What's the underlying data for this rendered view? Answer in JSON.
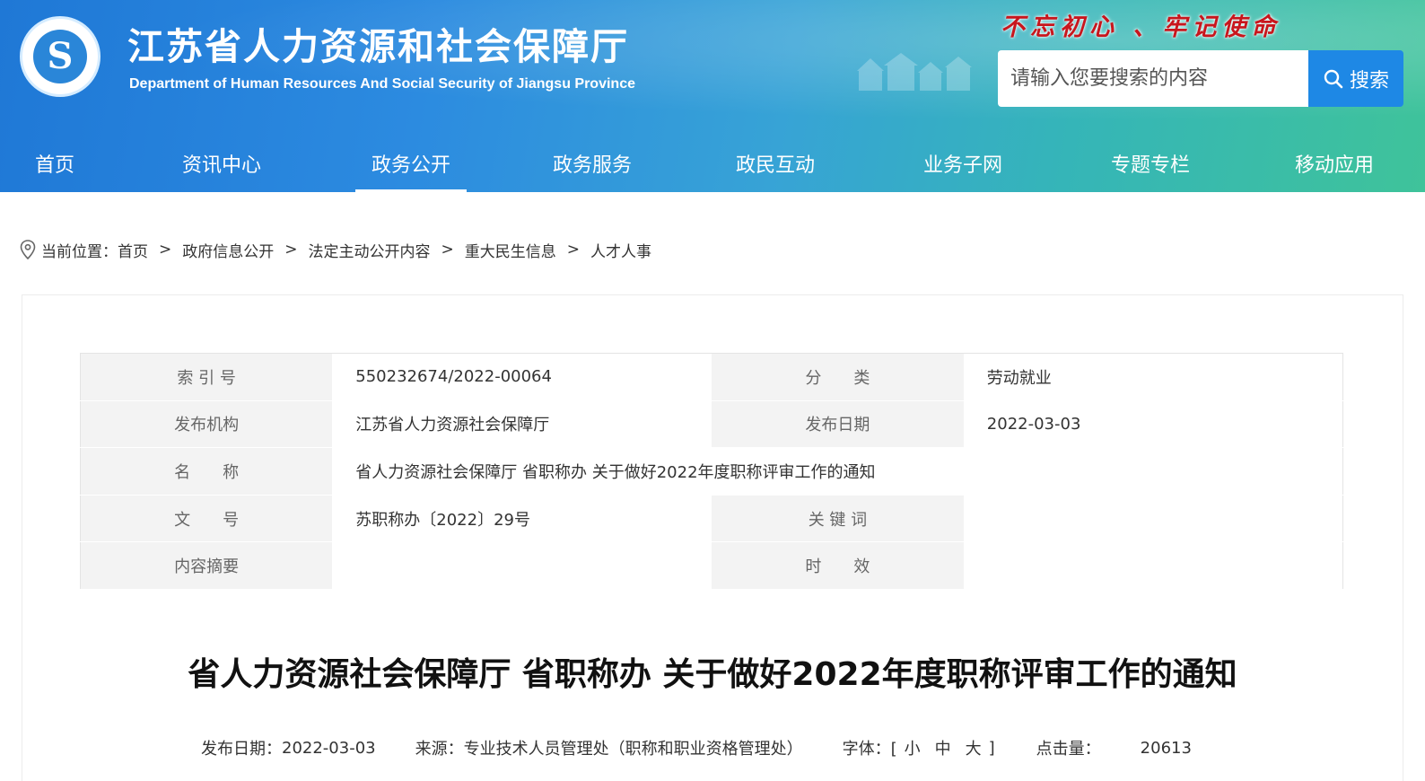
{
  "header": {
    "title_cn": "江苏省人力资源和社会保障厅",
    "title_en": "Department of Human Resources And Social Security of Jiangsu Province",
    "slogan": "不忘初心 、牢记使命",
    "search_placeholder": "请输入您要搜索的内容",
    "search_button": "搜索",
    "logo_icon": "ministry-logo-icon",
    "accent_color": "#1e88e5"
  },
  "nav": {
    "items": [
      {
        "label": "首页"
      },
      {
        "label": "资讯中心"
      },
      {
        "label": "政务公开"
      },
      {
        "label": "政务服务"
      },
      {
        "label": "政民互动"
      },
      {
        "label": "业务子网"
      },
      {
        "label": "专题专栏"
      },
      {
        "label": "移动应用"
      }
    ],
    "active_label": "政务公开"
  },
  "breadcrumb": {
    "prefix": "当前位置：",
    "items": [
      "首页",
      "政府信息公开",
      "法定主动公开内容",
      "重大民生信息",
      "人才人事"
    ],
    "separator": ">"
  },
  "meta": {
    "index_label": "索 引 号",
    "index_value": "550232674/2022-00064",
    "category_label": "分　　类",
    "category_value": "劳动就业",
    "publisher_label": "发布机构",
    "publisher_value": "江苏省人力资源社会保障厅",
    "date_label": "发布日期",
    "date_value": "2022-03-03",
    "name_label": "名　　称",
    "name_value": "省人力资源社会保障厅 省职称办 关于做好2022年度职称评审工作的通知",
    "docno_label": "文　　号",
    "docno_value": "苏职称办〔2022〕29号",
    "keywords_label": "关 键 词",
    "keywords_value": "",
    "summary_label": "内容摘要",
    "summary_value": "",
    "validity_label": "时　　效",
    "validity_value": ""
  },
  "document": {
    "title": "省人力资源社会保障厅 省职称办 关于做好2022年度职称评审工作的通知",
    "date_label": "发布日期：",
    "date_value": "2022-03-03",
    "source_label": "来源：",
    "source_value": "专业技术人员管理处（职称和职业资格管理处）",
    "font_label": "字体：[",
    "font_small": "小",
    "font_medium": "中",
    "font_large": "大",
    "font_close": "]",
    "hits_label": "点击量：",
    "hits_value": "20613"
  }
}
